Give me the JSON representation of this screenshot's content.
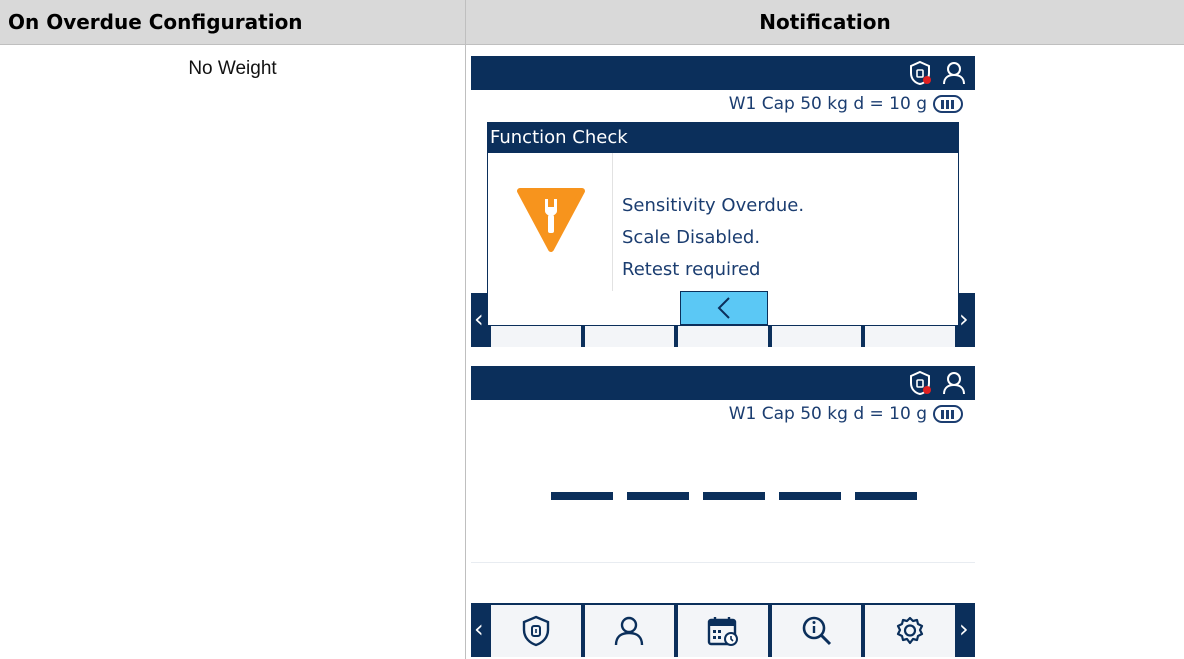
{
  "table": {
    "header_left": "On Overdue Configuration",
    "header_right": "Notification",
    "row_label": "No Weight"
  },
  "screens": {
    "cap_line": "W1 Cap 50 kg d = 10 g",
    "dialog": {
      "title": "Function Check",
      "lines": [
        "Sensitivity Overdue.",
        "Scale Disabled.",
        "Retest required"
      ]
    }
  },
  "colors": {
    "navy": "#0b2f5b",
    "accent_blue": "#5bc8f5",
    "warning_orange": "#f7941d"
  },
  "icons": [
    "scale-lock-icon",
    "user-icon",
    "battery-icon",
    "warning-wrench-icon",
    "back-chevron-icon",
    "calendar-icon",
    "search-info-icon",
    "gear-icon"
  ]
}
